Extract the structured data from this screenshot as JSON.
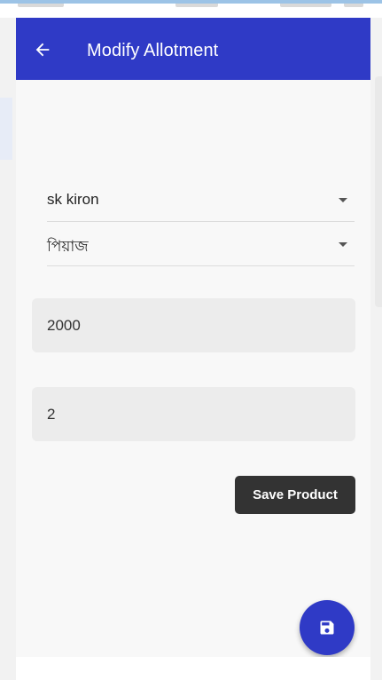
{
  "appbar": {
    "title": "Modify Allotment",
    "back_icon": "arrow-left-icon",
    "color": "#2f3ac6"
  },
  "form": {
    "user_select": {
      "value": "sk kiron"
    },
    "product_select": {
      "value": "পিয়াজ"
    },
    "quantity_field": {
      "value": "2000"
    },
    "second_field": {
      "value": "2"
    },
    "save_button": {
      "label": "Save Product",
      "color": "#333333"
    }
  },
  "fab": {
    "icon": "floppy-disk-icon",
    "color": "#2f3ac6"
  }
}
